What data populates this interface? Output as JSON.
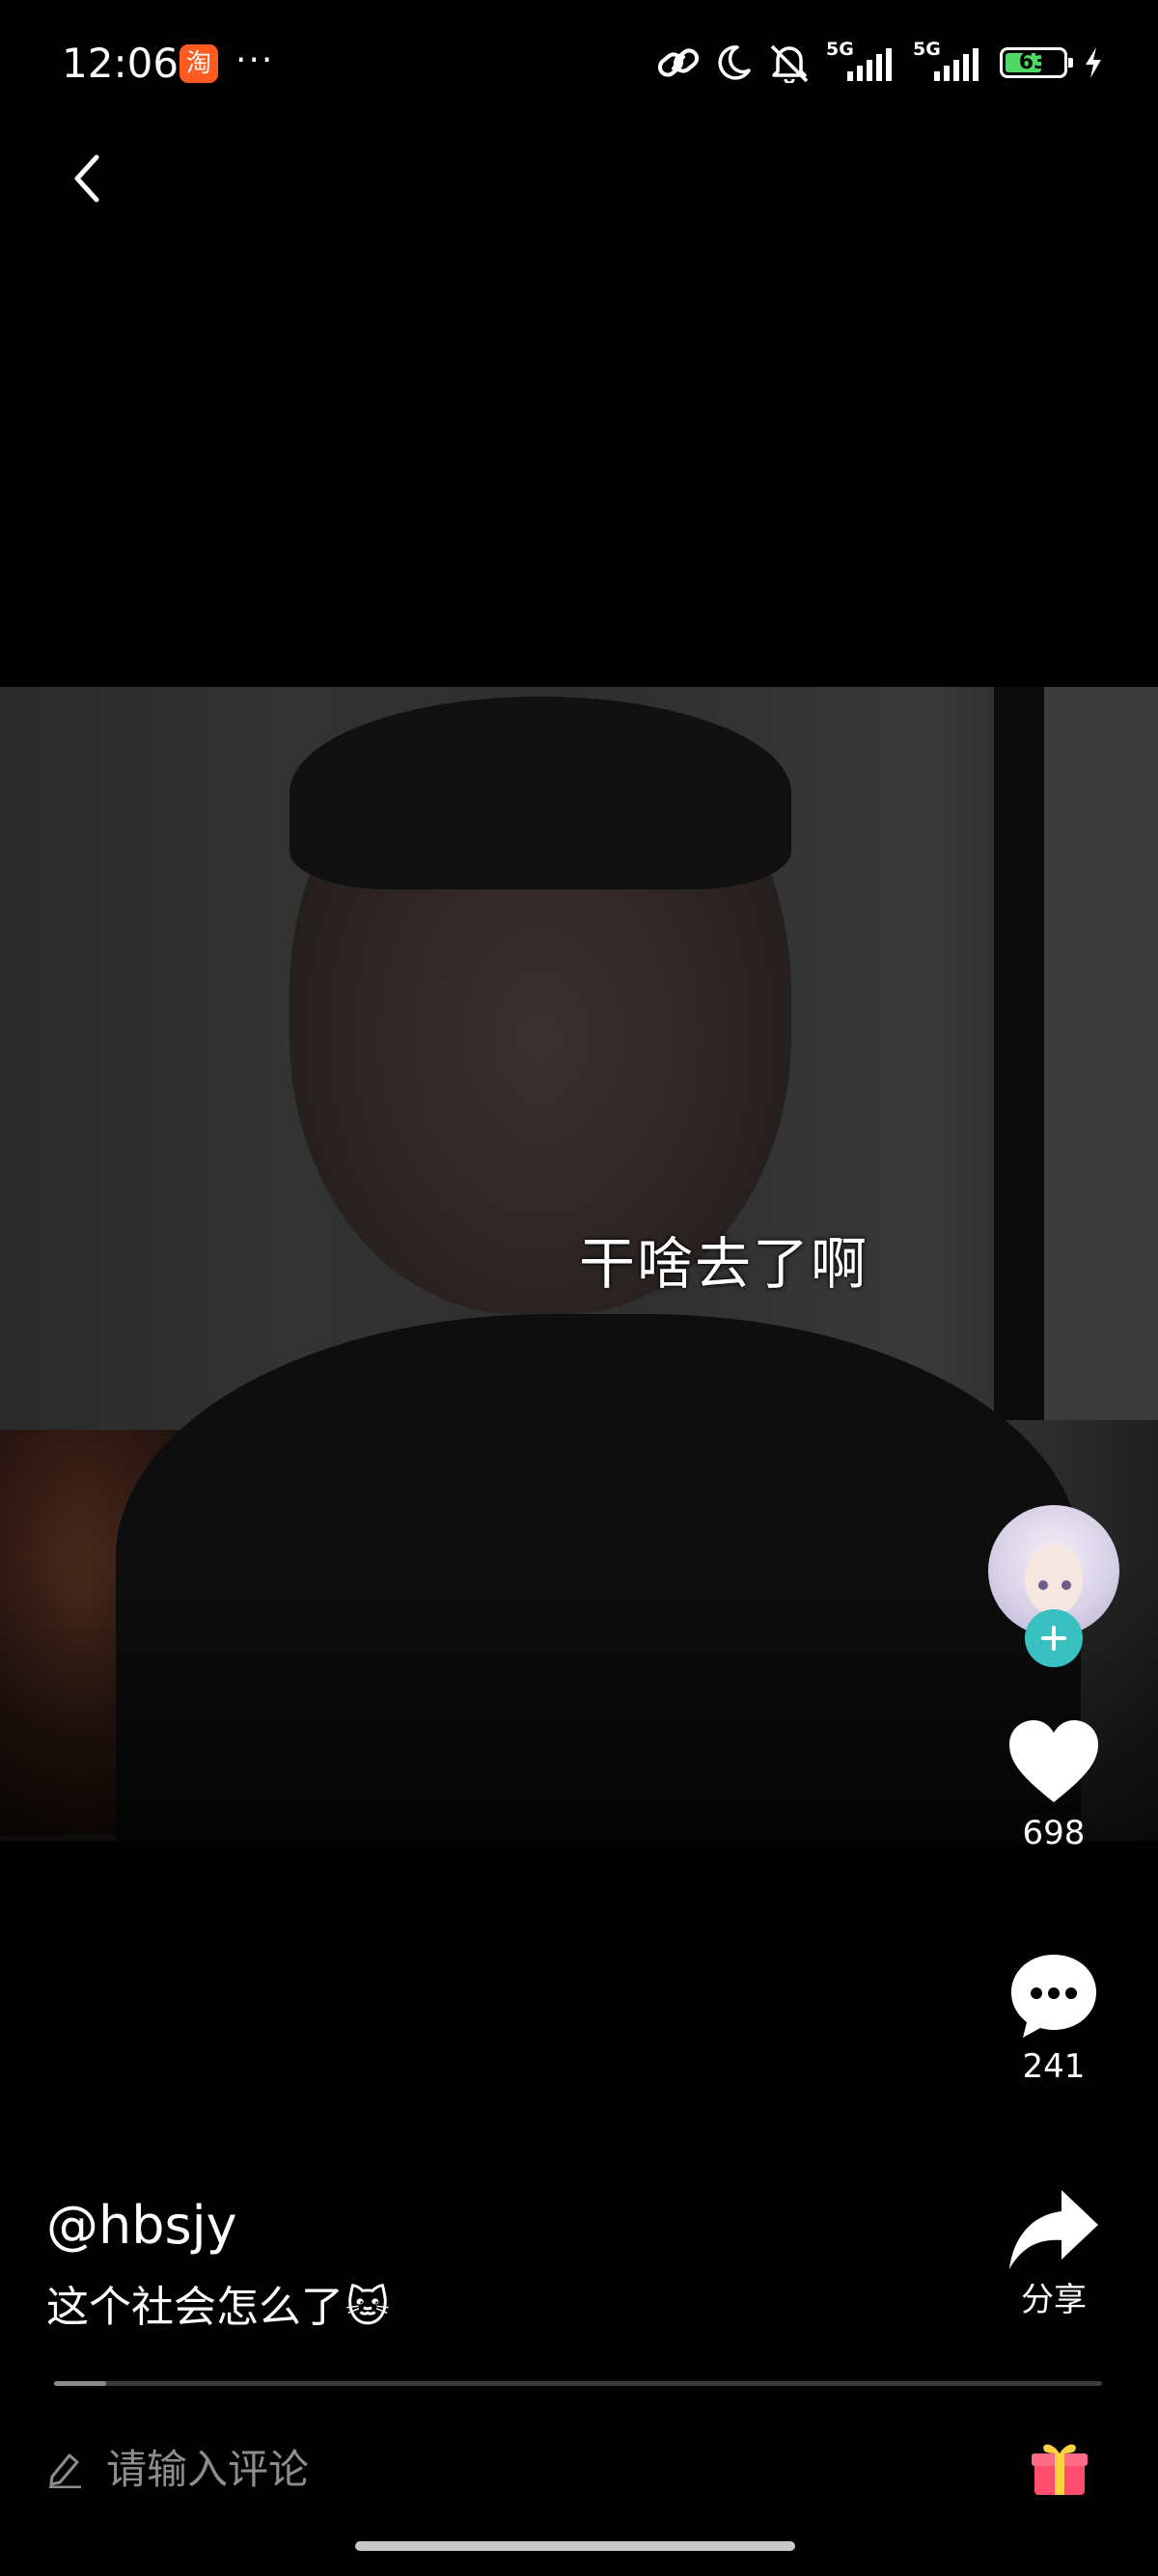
{
  "status_bar": {
    "time": "12:06",
    "app_badge": "淘",
    "more": "···",
    "signal1_label": "5G",
    "signal2_label": "5G",
    "battery": "63",
    "battery_level": 0.63,
    "battery_color": "#4cd964"
  },
  "video": {
    "subtitle": "干啥去了啊"
  },
  "rail": {
    "likes": "698",
    "comments": "241",
    "share_label": "分享",
    "follow_color": "#39c1c2"
  },
  "post": {
    "author": "@hbsjy",
    "caption": "这个社会怎么了",
    "caption_emoji": "🐱"
  },
  "playback": {
    "progress": 0.05
  },
  "comment": {
    "placeholder": "请输入评论"
  },
  "icons": [
    "back-icon",
    "link-icon",
    "moon-icon",
    "mute-icon",
    "signal-icon",
    "battery-icon",
    "charging-icon",
    "heart-icon",
    "comment-icon",
    "share-icon",
    "pencil-icon",
    "gift-icon",
    "plus-icon"
  ]
}
